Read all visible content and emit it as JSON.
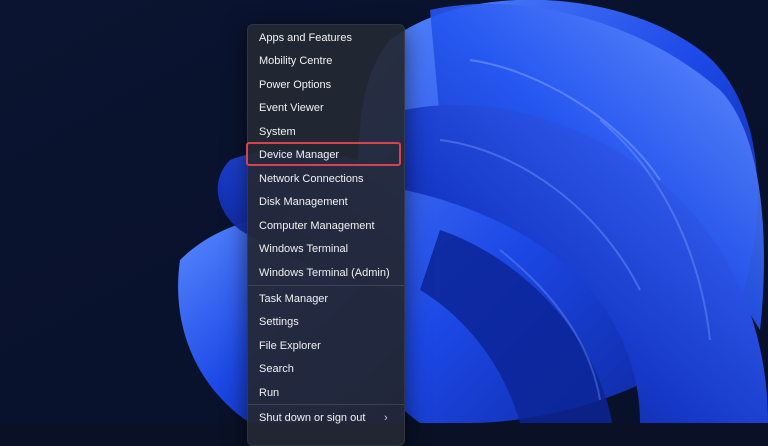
{
  "menu": {
    "items": [
      {
        "label": "Apps and Features"
      },
      {
        "label": "Mobility Centre"
      },
      {
        "label": "Power Options"
      },
      {
        "label": "Event Viewer"
      },
      {
        "label": "System"
      },
      {
        "label": "Device Manager",
        "highlighted": true
      },
      {
        "label": "Network Connections"
      },
      {
        "label": "Disk Management"
      },
      {
        "label": "Computer Management"
      },
      {
        "label": "Windows Terminal"
      },
      {
        "label": "Windows Terminal (Admin)"
      },
      {
        "label": "Task Manager"
      },
      {
        "label": "Settings"
      },
      {
        "label": "File Explorer"
      },
      {
        "label": "Search"
      },
      {
        "label": "Run"
      },
      {
        "label": "Shut down or sign out",
        "submenu_indicator": "›"
      }
    ]
  },
  "colors": {
    "highlight_border": "#d8414f",
    "menu_background": "#242834",
    "wallpaper_blue": "#1e4ee8"
  },
  "icons": {
    "submenu": "chevron-right-icon"
  }
}
